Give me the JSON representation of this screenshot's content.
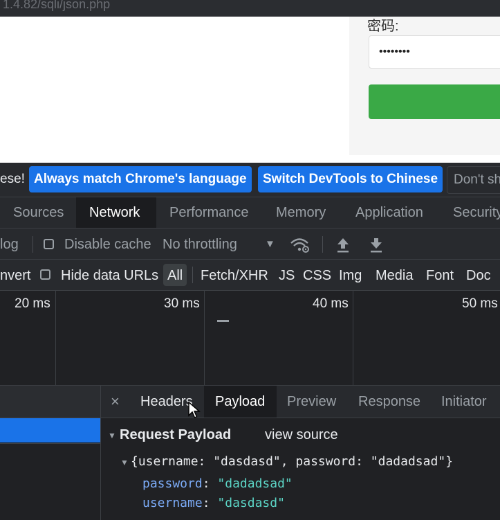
{
  "browser": {
    "url": "1.4.82/sqli/json.php"
  },
  "page": {
    "password_label": "密码:",
    "password_value": "••••••••",
    "submit_color": "#3aa946"
  },
  "infobar": {
    "text": "ese!",
    "always_match": "Always match Chrome's language",
    "switch_devtools": "Switch DevTools to Chinese",
    "dont_show": "Don't sh"
  },
  "panel_tabs": [
    "Sources",
    "Network",
    "Performance",
    "Memory",
    "Application",
    "Security"
  ],
  "active_panel": "Network",
  "toolbar": {
    "preserve_log": "log",
    "disable_cache": "Disable cache",
    "throttling": "No throttling",
    "dropdown_arrow": "▼",
    "wifi_icon": "network-conditions-icon",
    "upload_icon": "import-har-icon",
    "download_icon": "export-har-icon"
  },
  "filter": {
    "invert": "nvert",
    "hide_data_urls": "Hide data URLs",
    "types": [
      "All",
      "Fetch/XHR",
      "JS",
      "CSS",
      "Img",
      "Media",
      "Font",
      "Doc"
    ],
    "active_type": "All"
  },
  "timeline": {
    "ticks": [
      "20 ms",
      "30 ms",
      "40 ms",
      "50 ms"
    ]
  },
  "details": {
    "close": "×",
    "tabs": [
      "Headers",
      "Payload",
      "Preview",
      "Response",
      "Initiator"
    ],
    "active_tab": "Payload",
    "section_title": "Request Payload",
    "view_source": "view source",
    "summary": "{username: \"dasdasd\", password: \"dadadsad\"}",
    "props": [
      {
        "key": "password",
        "value": "\"dadadsad\""
      },
      {
        "key": "username",
        "value": "\"dasdasd\""
      }
    ],
    "key_color": "#7cacf8",
    "value_color": "#5cd5c6"
  }
}
